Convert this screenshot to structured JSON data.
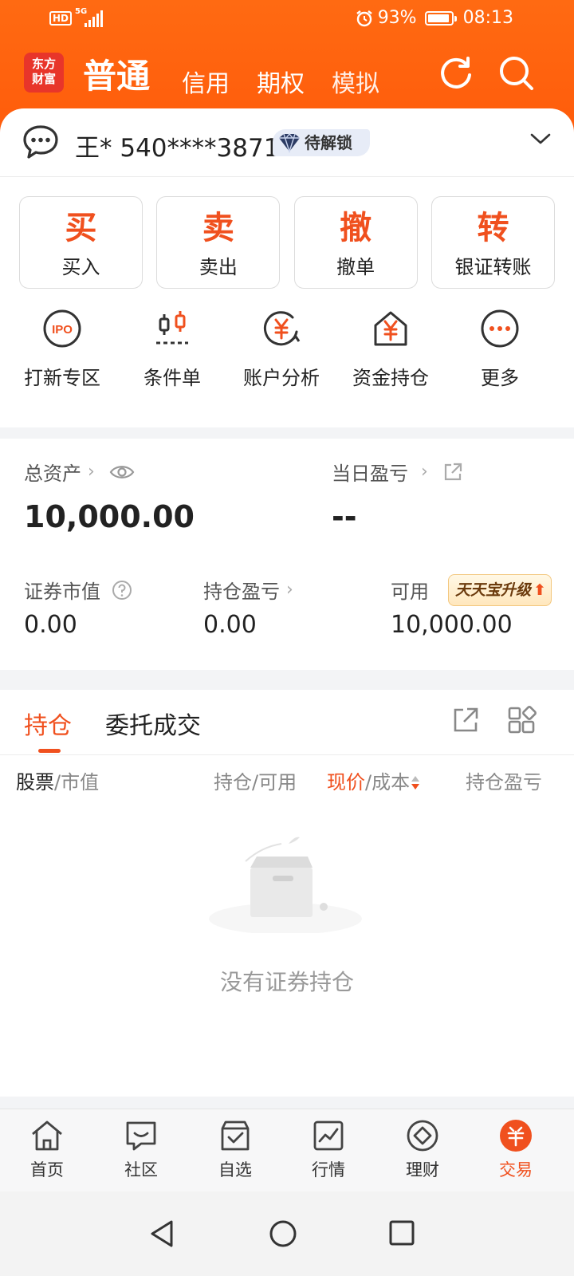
{
  "status_bar": {
    "hd": "HD",
    "network": "5G",
    "battery": "93%",
    "time": "08:13"
  },
  "header": {
    "logo_line1": "东方",
    "logo_line2": "财富",
    "tabs": [
      "普通",
      "信用",
      "期权",
      "模拟"
    ],
    "active_tab": "普通"
  },
  "account": {
    "text": "王* 540****3871",
    "badge": "待解锁"
  },
  "trade_buttons": [
    {
      "big": "买",
      "small": "买入"
    },
    {
      "big": "卖",
      "small": "卖出"
    },
    {
      "big": "撤",
      "small": "撤单"
    },
    {
      "big": "转",
      "small": "银证转账"
    }
  ],
  "quick_actions": [
    {
      "label": "打新专区",
      "icon": "ipo-icon",
      "icon_text": "IPO"
    },
    {
      "label": "条件单",
      "icon": "candlestick-icon"
    },
    {
      "label": "账户分析",
      "icon": "yuan-analysis-icon"
    },
    {
      "label": "资金持仓",
      "icon": "yuan-house-icon"
    },
    {
      "label": "更多",
      "icon": "more-icon"
    }
  ],
  "assets": {
    "total_label": "总资产",
    "total_value": "10,000.00",
    "daily_pl_label": "当日盈亏",
    "daily_pl_value": "--",
    "market_value_label": "证券市值",
    "market_value": "0.00",
    "position_pl_label": "持仓盈亏",
    "position_pl": "0.00",
    "available_label": "可用",
    "available": "10,000.00",
    "upgrade_badge": "天天宝升级"
  },
  "holdings": {
    "tabs": [
      "持仓",
      "委托成交"
    ],
    "columns": [
      {
        "main": "股票",
        "sub": "/市值"
      },
      {
        "main": "持仓",
        "sub": "/可用"
      },
      {
        "main": "现价",
        "sub": "/成本"
      },
      {
        "main": "持仓盈亏",
        "sub": ""
      }
    ],
    "empty_text": "没有证券持仓"
  },
  "bottom_nav": [
    {
      "label": "首页",
      "icon": "home-icon"
    },
    {
      "label": "社区",
      "icon": "community-icon"
    },
    {
      "label": "自选",
      "icon": "watchlist-icon"
    },
    {
      "label": "行情",
      "icon": "market-icon"
    },
    {
      "label": "理财",
      "icon": "wealth-icon"
    },
    {
      "label": "交易",
      "icon": "trade-icon"
    }
  ],
  "colors": {
    "brand_orange": "#ff5a0a",
    "accent": "#f0501e"
  }
}
